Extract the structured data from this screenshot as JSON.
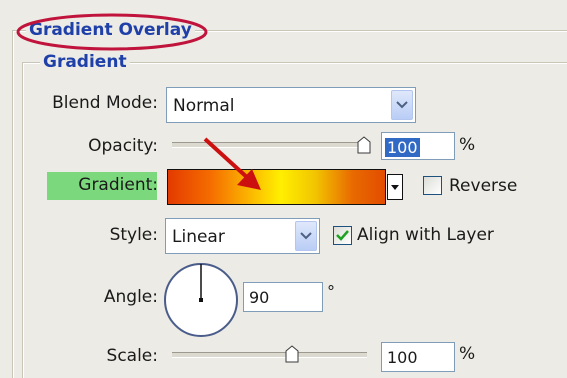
{
  "panel": {
    "title": "Gradient Overlay",
    "group_title": "Gradient"
  },
  "blend_mode": {
    "label": "Blend Mode:",
    "value": "Normal"
  },
  "opacity": {
    "label": "Opacity:",
    "value": "100",
    "unit": "%",
    "level": 1.0
  },
  "gradient": {
    "label": "Gradient:",
    "colors": [
      "#e43a00",
      "#f56e00",
      "#fbb800",
      "#ffef00",
      "#f2c400",
      "#e86a00",
      "#e34c00"
    ],
    "reverse_label": "Reverse",
    "reverse_checked": false
  },
  "style": {
    "label": "Style:",
    "value": "Linear"
  },
  "align_with_layer": {
    "label": "Align with Layer",
    "checked": true
  },
  "angle": {
    "label": "Angle:",
    "value": "90",
    "unit": "°",
    "degrees": 90
  },
  "scale": {
    "label": "Scale:",
    "value": "100",
    "unit": "%",
    "level": 0.5
  },
  "annotations": {
    "highlight_color": "#c0143c",
    "arrow_color": "#cc1010",
    "label_highlight": "#7cd87c"
  }
}
